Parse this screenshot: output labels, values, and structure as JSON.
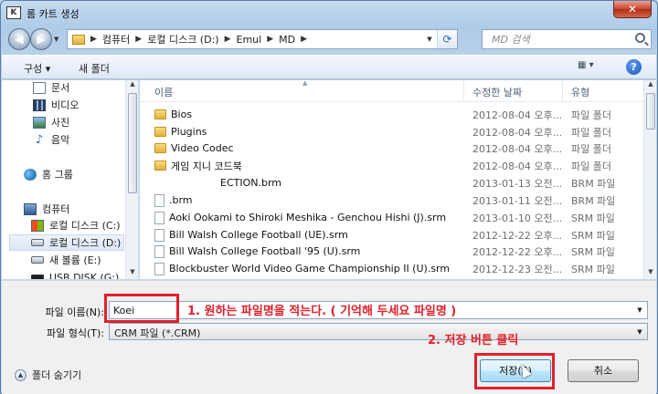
{
  "window": {
    "title": "롬 카트 생성",
    "app_icon_text": "K",
    "close_glyph": "✕"
  },
  "navigation": {
    "back_glyph": "◀",
    "forward_glyph": "▶",
    "breadcrumb": [
      "컴퓨터",
      "로컬 디스크 (D:)",
      "Emul",
      "MD"
    ],
    "search_placeholder": "MD 검색"
  },
  "toolbar": {
    "organize_label": "구성 ▾",
    "new_folder_label": "새 폴더",
    "view_glyph": "▦ ▾",
    "help_glyph": "?"
  },
  "sidebar": {
    "items": [
      {
        "label": "문서",
        "icon": "document-icon"
      },
      {
        "label": "비디오",
        "icon": "video-icon"
      },
      {
        "label": "사진",
        "icon": "photo-icon"
      },
      {
        "label": "음악",
        "icon": "music-icon"
      },
      {
        "label": "홈 그룹",
        "icon": "homegroup-icon"
      },
      {
        "label": "컴퓨터",
        "icon": "computer-icon"
      },
      {
        "label": "로컬 디스크 (C:)",
        "icon": "windows-drive-icon"
      },
      {
        "label": "로컬 디스크 (D:)",
        "icon": "drive-icon",
        "selected": true
      },
      {
        "label": "새 볼륨 (E:)",
        "icon": "drive-icon"
      },
      {
        "label": "USB DISK (G:)",
        "icon": "usb-icon"
      }
    ]
  },
  "file_list": {
    "columns": [
      "이름",
      "수정한 날짜",
      "유형"
    ],
    "rows": [
      {
        "name": "Bios",
        "date": "2012-08-04 오후...",
        "type": "파일 폴더",
        "kind": "folder"
      },
      {
        "name": "Plugins",
        "date": "2012-08-04 오후...",
        "type": "파일 폴더",
        "kind": "folder"
      },
      {
        "name": "Video Codec",
        "date": "2012-08-04 오후...",
        "type": "파일 폴더",
        "kind": "folder"
      },
      {
        "name": "게임 지니 코드북",
        "date": "2012-08-04 오후...",
        "type": "파일 폴더",
        "kind": "folder"
      },
      {
        "name": "ECTION.brm",
        "date": "2013-01-13 오전...",
        "type": "BRM 파일",
        "kind": "blank"
      },
      {
        "name": ".brm",
        "date": "2013-01-11 오전...",
        "type": "BRM 파일",
        "kind": "file"
      },
      {
        "name": "Aoki Ookami to Shiroki Meshika - Genchou Hishi (J).srm",
        "date": "2013-01-10 오전...",
        "type": "SRM 파일",
        "kind": "file"
      },
      {
        "name": "Bill Walsh College Football (UE).srm",
        "date": "2012-12-22 오후...",
        "type": "SRM 파일",
        "kind": "file"
      },
      {
        "name": "Bill Walsh College Football '95 (U).srm",
        "date": "2012-12-22 오후...",
        "type": "SRM 파일",
        "kind": "file"
      },
      {
        "name": "Blockbuster World Video Game Championship II (U).srm",
        "date": "2012-12-23 오전...",
        "type": "SRM 파일",
        "kind": "file"
      }
    ]
  },
  "form": {
    "filename_label": "파일 이름(N):",
    "filename_value": "Koei",
    "filetype_label": "파일 형식(T):",
    "filetype_value": "CRM 파일 (*.CRM)",
    "hide_folders_label": "폴더 숨기기",
    "save_label": "저장(S)",
    "cancel_label": "취소"
  },
  "annotations": {
    "step1": "1. 원하는 파일명을 적는다. ( 기억해 두세요 파일명 )",
    "step2": "2. 저장 버튼 클릭",
    "color": "#e2202a"
  }
}
